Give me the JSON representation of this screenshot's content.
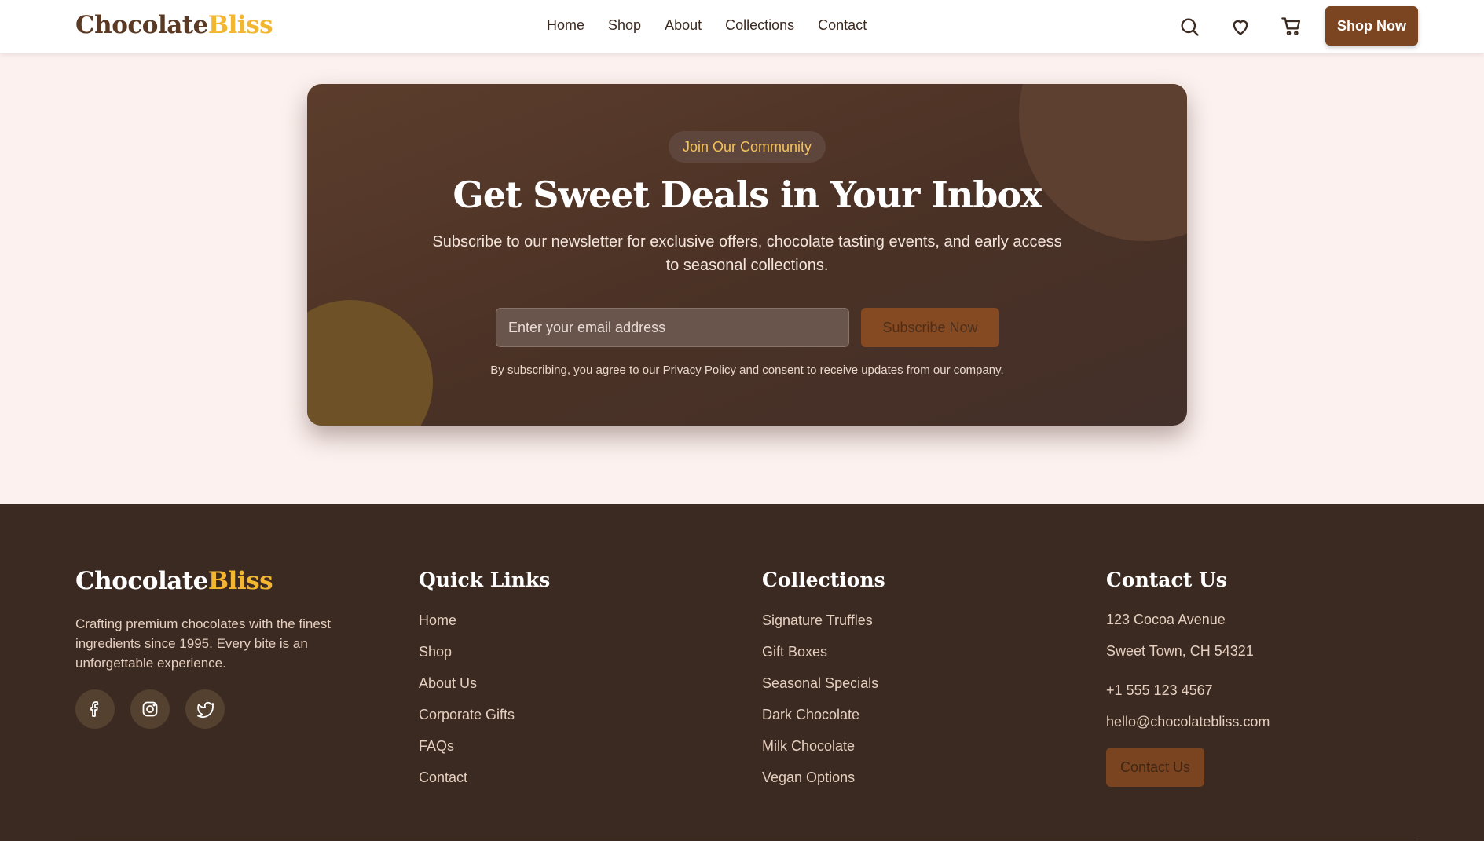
{
  "header": {
    "logo_part1": "Chocolate",
    "logo_part2": "Bliss",
    "nav": [
      "Home",
      "Shop",
      "About",
      "Collections",
      "Contact"
    ],
    "icons": [
      "search-icon",
      "heart-icon",
      "cart-icon"
    ],
    "cta_label": "Shop Now"
  },
  "newsletter": {
    "badge": "Join Our Community",
    "title": "Get Sweet Deals in Your Inbox",
    "subtitle": "Subscribe to our newsletter for exclusive offers, chocolate tasting events, and early access to seasonal collections.",
    "email_placeholder": "Enter your email address",
    "button_label": "Subscribe Now",
    "legal": "By subscribing, you agree to our Privacy Policy and consent to receive updates from our company."
  },
  "footer": {
    "logo_part1": "Chocolate",
    "logo_part2": "Bliss",
    "description": "Crafting premium chocolates with the finest ingredients since 1995. Every bite is an unforgettable experience.",
    "social": [
      "facebook-icon",
      "instagram-icon",
      "twitter-icon"
    ],
    "quick_links": {
      "heading": "Quick Links",
      "items": [
        "Home",
        "Shop",
        "About Us",
        "Corporate Gifts",
        "FAQs",
        "Contact"
      ]
    },
    "collections": {
      "heading": "Collections",
      "items": [
        "Signature Truffles",
        "Gift Boxes",
        "Seasonal Specials",
        "Dark Chocolate",
        "Milk Chocolate",
        "Vegan Options"
      ]
    },
    "contact": {
      "heading": "Contact Us",
      "address_line1": "123 Cocoa Avenue",
      "address_line2": "Sweet Town, CH 54321",
      "phone": "+1 555 123 4567",
      "email": "hello@chocolatebliss.com",
      "button_label": "Contact Us"
    }
  },
  "colors": {
    "brand_brown": "#7c4522",
    "brand_gold": "#f2b630",
    "footer_bg": "#3b2a21",
    "page_bg": "#fcf1ef"
  }
}
